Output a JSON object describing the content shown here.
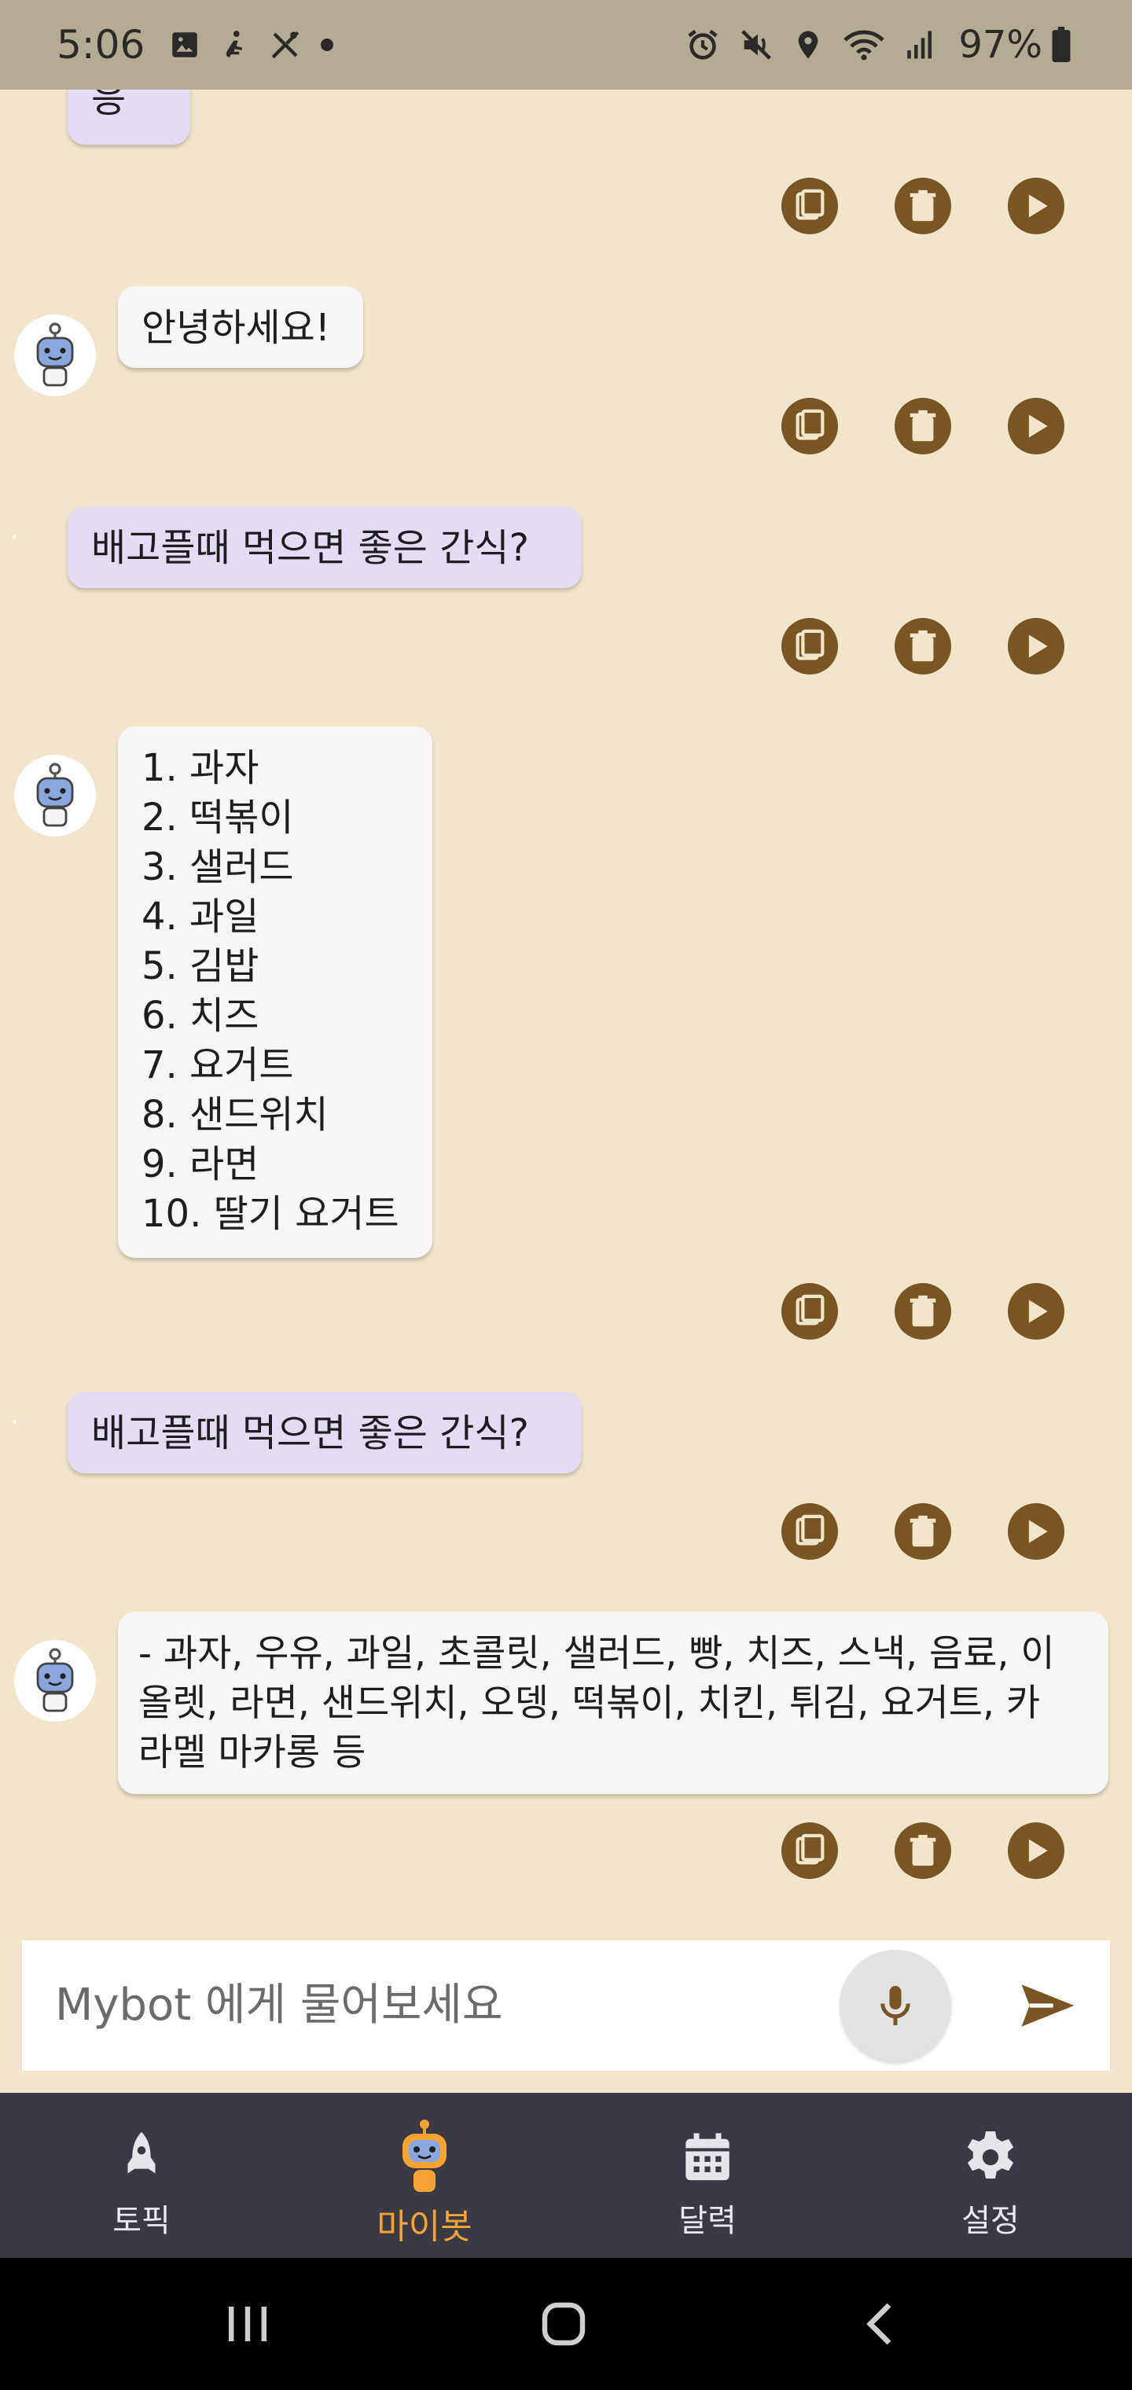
{
  "status_bar": {
    "time": "5:06",
    "battery": "97%"
  },
  "messages": [
    {
      "role": "user",
      "text": "응 ㅇ"
    },
    {
      "role": "bot",
      "text": "안녕하세요!"
    },
    {
      "role": "user",
      "text": "배고플때 먹으면 좋은 간식?"
    },
    {
      "role": "bot",
      "text": "1. 과자\n2. 떡볶이\n3. 샐러드\n4. 과일\n5. 김밥\n6. 치즈\n7. 요거트\n8. 샌드위치\n9. 라면\n10. 딸기 요거트"
    },
    {
      "role": "user",
      "text": "배고플때 먹으면 좋은 간식?"
    },
    {
      "role": "bot",
      "text": "- 과자, 우유, 과일, 초콜릿, 샐러드, 빵, 치즈, 스낵, 음료, 이\n올렛, 라면, 샌드위치, 오뎅, 떡볶이, 치킨, 튀김, 요거트, 카\n라멜 마카롱 등"
    }
  ],
  "message_actions": [
    "copy-icon",
    "delete-icon",
    "play-icon"
  ],
  "input": {
    "placeholder": "Mybot 에게 물어보세요"
  },
  "nav": [
    {
      "label": "토픽",
      "icon": "rocket-icon",
      "active": false
    },
    {
      "label": "마이봇",
      "icon": "robot-icon",
      "active": true
    },
    {
      "label": "달력",
      "icon": "calendar-icon",
      "active": false
    },
    {
      "label": "설정",
      "icon": "gear-icon",
      "active": false
    }
  ],
  "colors": {
    "background": "#f1e6cc",
    "user_bubble": "#e3dcf3",
    "bot_bubble": "#f6f6f6",
    "action_button": "#7a5422",
    "nav_background": "#3a3a45",
    "nav_active": "#f5a234"
  }
}
